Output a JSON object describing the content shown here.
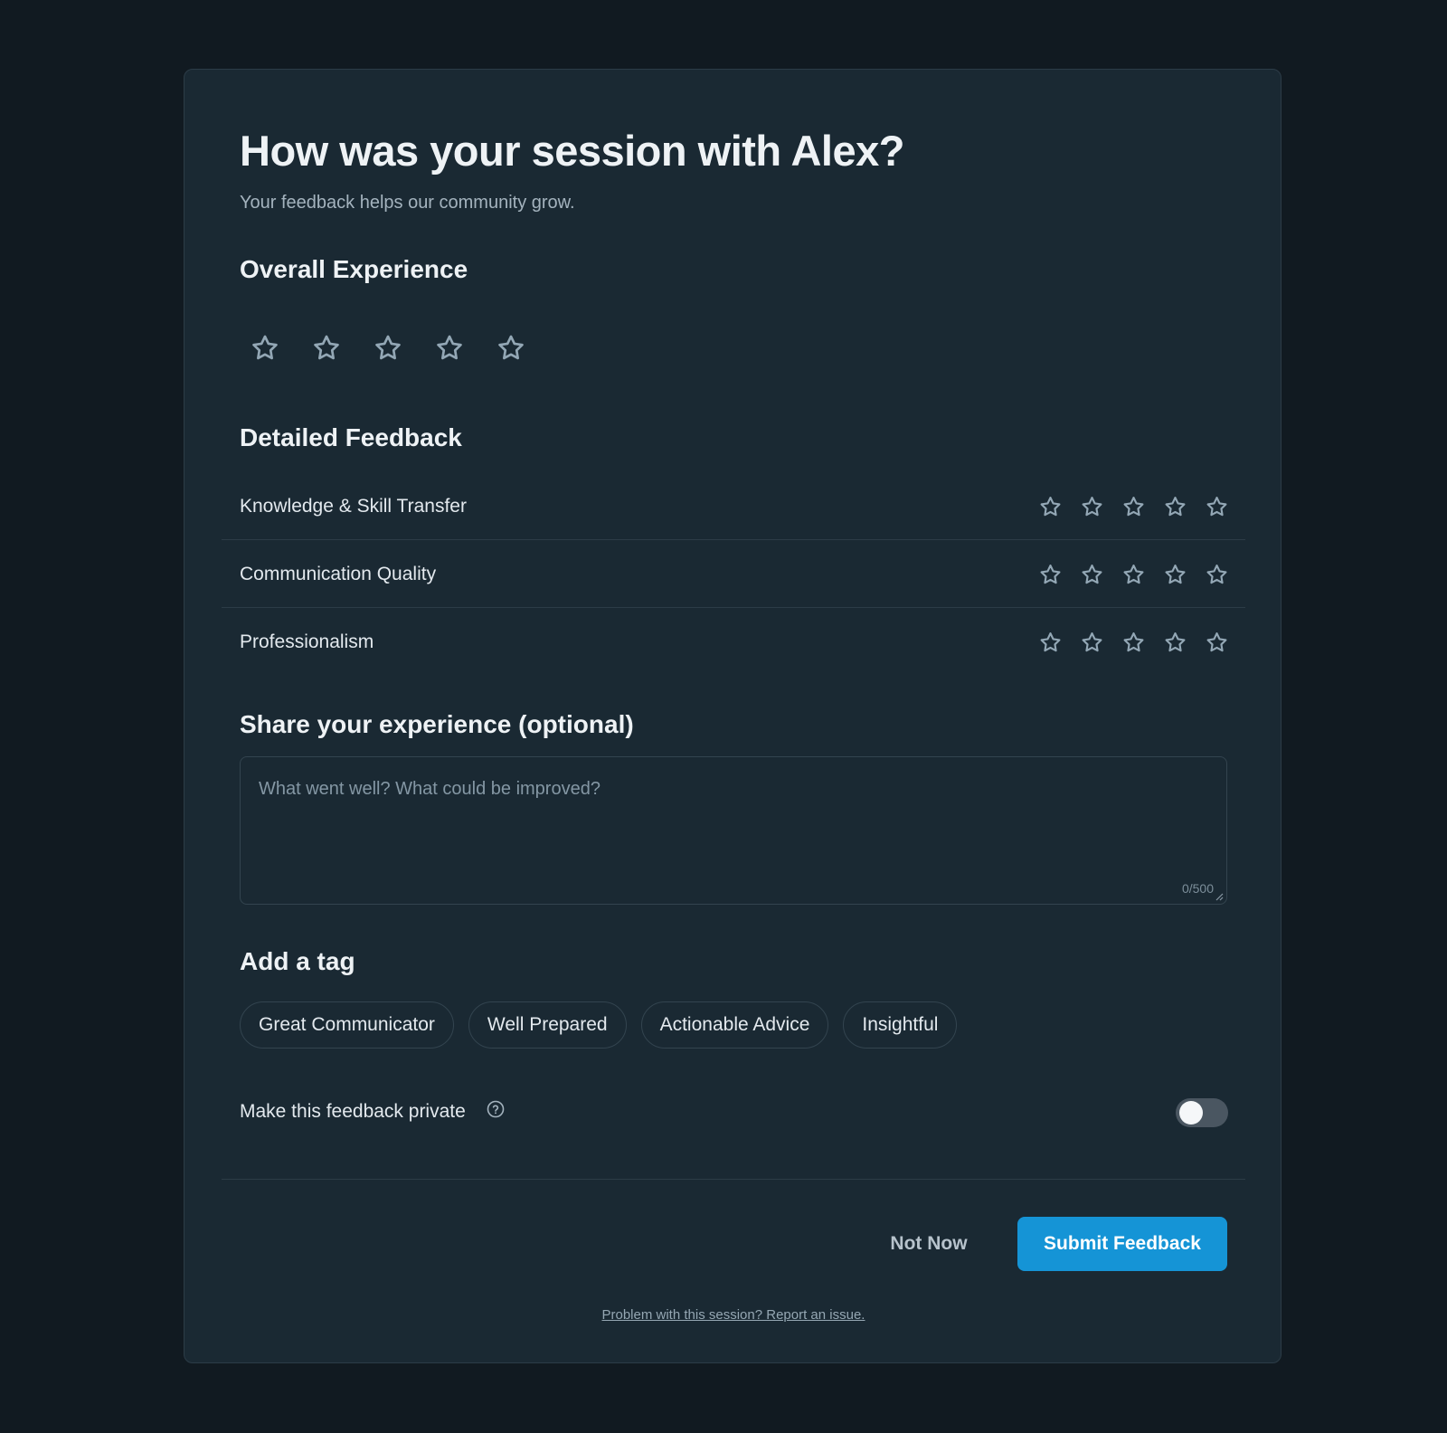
{
  "title": "How was your session with Alex?",
  "subtitle": "Your feedback helps our community grow.",
  "overall": {
    "heading": "Overall Experience",
    "rating": 0,
    "max_rating": 5,
    "star_icon": "star-outline-icon"
  },
  "detailed": {
    "heading": "Detailed Feedback",
    "rows": [
      {
        "label": "Knowledge & Skill Transfer",
        "rating": 0,
        "max_rating": 5
      },
      {
        "label": "Communication Quality",
        "rating": 0,
        "max_rating": 5
      },
      {
        "label": "Professionalism",
        "rating": 0,
        "max_rating": 5
      }
    ]
  },
  "comment": {
    "heading": "Share your experience (optional)",
    "placeholder": "What went well? What could be improved?",
    "value": "",
    "counter": "0/500"
  },
  "tags": {
    "heading": "Add a tag",
    "items": [
      "Great Communicator",
      "Well Prepared",
      "Actionable Advice",
      "Insightful"
    ]
  },
  "private": {
    "label": "Make this feedback private",
    "help_icon": "help-circle-icon",
    "enabled": false
  },
  "actions": {
    "secondary_label": "Not Now",
    "primary_label": "Submit Feedback"
  },
  "footer": {
    "report_link": "Problem with this session? Report an issue."
  },
  "colors": {
    "background": "#111a21",
    "card": "#1a2933",
    "accent": "#1594d6",
    "star_outline": "#93a7b5"
  }
}
